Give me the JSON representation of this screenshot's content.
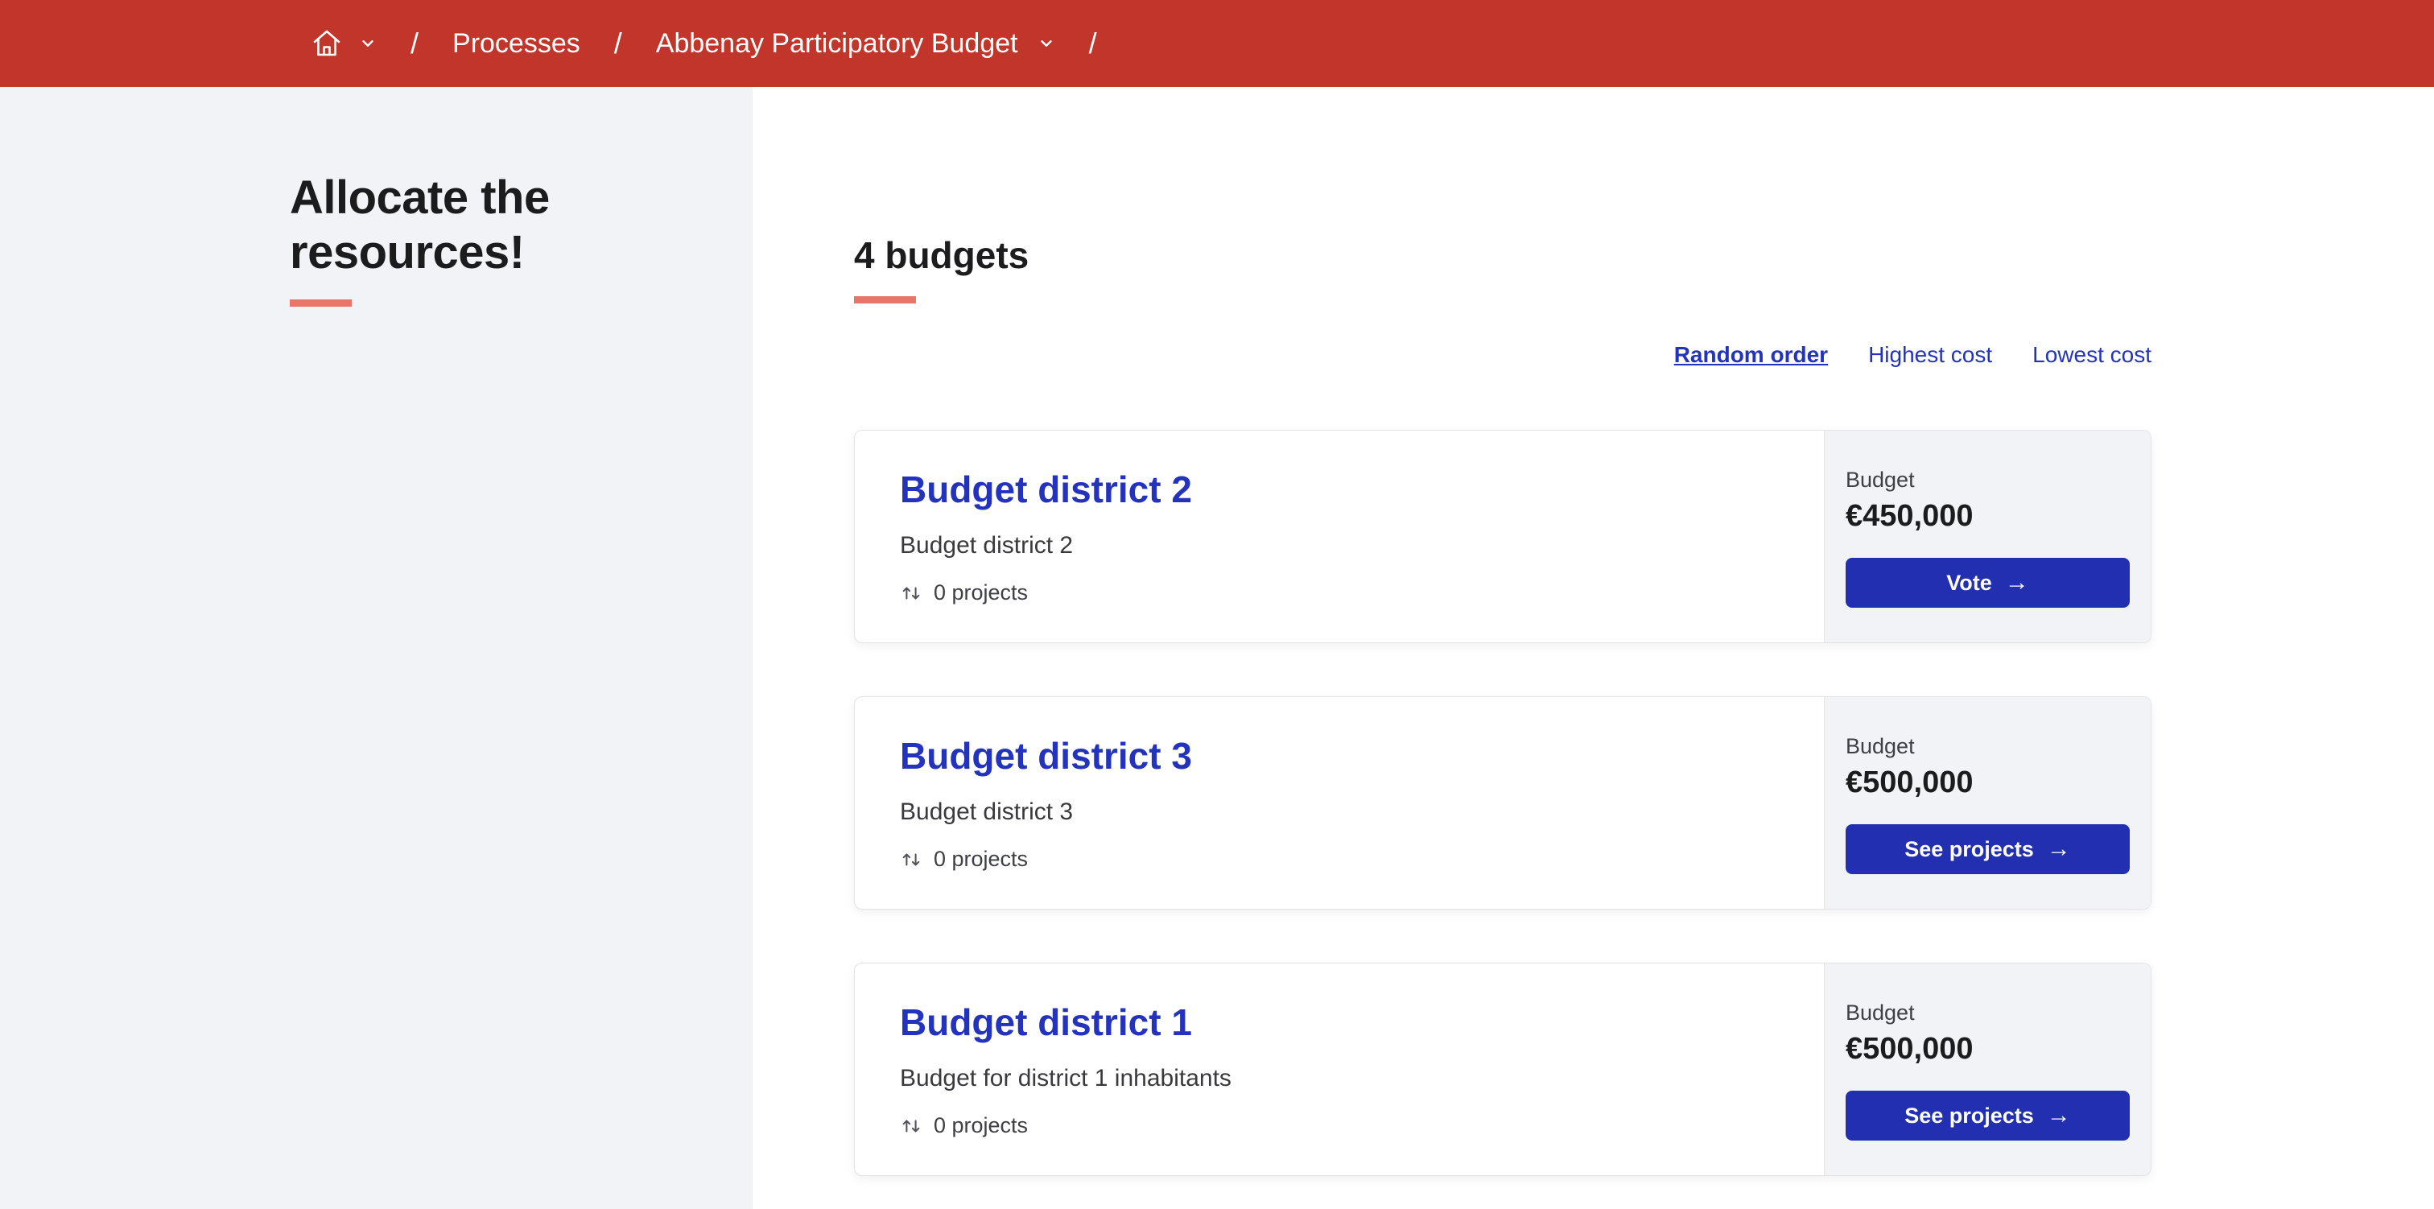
{
  "colors": {
    "topbar_red": "#c2352a",
    "accent_salmon": "#e8756a",
    "link_blue": "#2433be",
    "button_blue": "#222fb0",
    "sidebar_gray": "#f2f3f7",
    "card_aside_gray": "#f2f3f6"
  },
  "breadcrumb": {
    "separator": "/",
    "items": [
      {
        "label": "Processes"
      },
      {
        "label": "Abbenay Participatory Budget"
      }
    ]
  },
  "sidebar": {
    "title": "Allocate the resources!"
  },
  "main": {
    "heading": "4 budgets",
    "sort_options": [
      {
        "label": "Random order",
        "active": true
      },
      {
        "label": "Highest cost",
        "active": false
      },
      {
        "label": "Lowest cost",
        "active": false
      }
    ],
    "budgets": [
      {
        "title": "Budget district 2",
        "description": "Budget district 2",
        "projects_count": "0 projects",
        "budget_label": "Budget",
        "amount": "€450,000",
        "action_label": "Vote"
      },
      {
        "title": "Budget district 3",
        "description": "Budget district 3",
        "projects_count": "0 projects",
        "budget_label": "Budget",
        "amount": "€500,000",
        "action_label": "See projects"
      },
      {
        "title": "Budget district 1",
        "description": "Budget for district 1 inhabitants",
        "projects_count": "0 projects",
        "budget_label": "Budget",
        "amount": "€500,000",
        "action_label": "See projects"
      }
    ]
  }
}
